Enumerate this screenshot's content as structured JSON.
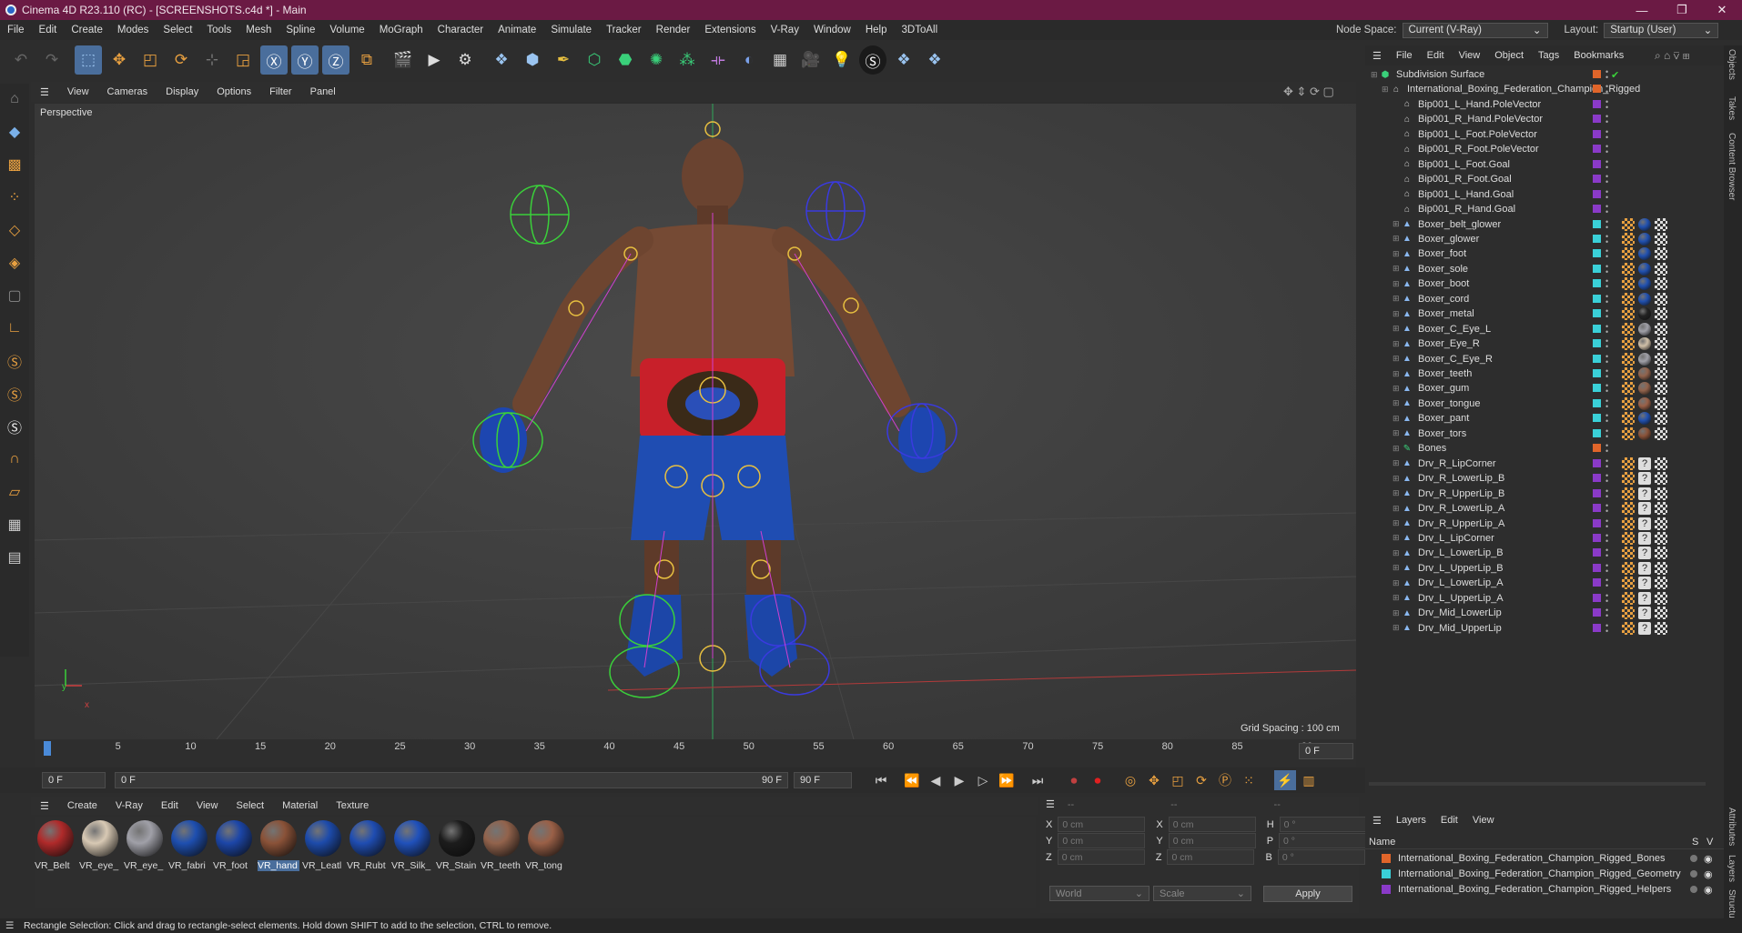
{
  "window": {
    "title": "Cinema 4D R23.110 (RC) - [SCREENSHOTS.c4d *] - Main",
    "controls": [
      "—",
      "❐",
      "✕"
    ]
  },
  "menubar": {
    "items": [
      "File",
      "Edit",
      "Create",
      "Modes",
      "Select",
      "Tools",
      "Mesh",
      "Spline",
      "Volume",
      "MoGraph",
      "Character",
      "Animate",
      "Simulate",
      "Tracker",
      "Render",
      "Extensions",
      "V-Ray",
      "Window",
      "Help",
      "3DToAll"
    ],
    "node_space_label": "Node Space:",
    "node_space_value": "Current (V-Ray)",
    "layout_label": "Layout:",
    "layout_value": "Startup (User)"
  },
  "viewport": {
    "menu": [
      "View",
      "Cameras",
      "Display",
      "Options",
      "Filter",
      "Panel"
    ],
    "label": "Perspective",
    "grid_spacing": "Grid Spacing : 100 cm",
    "axis_y": "y",
    "axis_x": "x"
  },
  "timeline": {
    "ticks": [
      "0",
      "5",
      "10",
      "15",
      "20",
      "25",
      "30",
      "35",
      "40",
      "45",
      "50",
      "55",
      "60",
      "65",
      "70",
      "75",
      "80",
      "85",
      "90"
    ],
    "end_field": "0 F",
    "start_field": "0 F",
    "range_start": "0 F",
    "range_end": "90 F",
    "max_field": "90 F",
    "playhead": 0,
    "max_frame": 90
  },
  "materials": {
    "menu": [
      "Create",
      "V-Ray",
      "Edit",
      "View",
      "Select",
      "Material",
      "Texture"
    ],
    "items": [
      {
        "name": "VR_Belt",
        "color": "#b02a2a"
      },
      {
        "name": "VR_eye_",
        "color": "#d8c9b4"
      },
      {
        "name": "VR_eye_",
        "color": "#a0a0a8"
      },
      {
        "name": "VR_fabri",
        "color": "#1e4fb0"
      },
      {
        "name": "VR_foot",
        "color": "#1c46a8"
      },
      {
        "name": "VR_hand",
        "color": "#8a5238"
      },
      {
        "name": "VR_Leatl",
        "color": "#1d4bab"
      },
      {
        "name": "VR_Rubt",
        "color": "#1f4db2"
      },
      {
        "name": "VR_Silk_",
        "color": "#2051bb"
      },
      {
        "name": "VR_Stain",
        "color": "#1c1c1c"
      },
      {
        "name": "VR_teeth",
        "color": "#92634c"
      },
      {
        "name": "VR_tong",
        "color": "#9a6047"
      }
    ],
    "selected_index": 5
  },
  "coords": {
    "header_left": "--",
    "header_mid": "--",
    "header_right": "--",
    "rows": [
      {
        "a": "X",
        "av": "0 cm",
        "b": "X",
        "bv": "0 cm",
        "c": "H",
        "cv": "0 °"
      },
      {
        "a": "Y",
        "av": "0 cm",
        "b": "Y",
        "bv": "0 cm",
        "c": "P",
        "cv": "0 °"
      },
      {
        "a": "Z",
        "av": "0 cm",
        "b": "Z",
        "bv": "0 cm",
        "c": "B",
        "cv": "0 °"
      }
    ],
    "space": "World",
    "mode": "Scale",
    "apply": "Apply"
  },
  "objects": {
    "menu": [
      "File",
      "Edit",
      "View",
      "Object",
      "Tags",
      "Bookmarks"
    ],
    "rows": [
      {
        "name": "Subdivision Surface",
        "kind": "subdiv",
        "color": "#e0652a",
        "indent": 0,
        "tags": "check"
      },
      {
        "name": "International_Boxing_Federation_Champion_Rigged",
        "kind": "null",
        "color": "#e0652a",
        "indent": 1,
        "tags": ""
      },
      {
        "name": "Bip001_L_Hand.PoleVector",
        "kind": "null",
        "color": "#8a3ac8",
        "indent": 2,
        "tags": ""
      },
      {
        "name": "Bip001_R_Hand.PoleVector",
        "kind": "null",
        "color": "#8a3ac8",
        "indent": 2,
        "tags": ""
      },
      {
        "name": "Bip001_L_Foot.PoleVector",
        "kind": "null",
        "color": "#8a3ac8",
        "indent": 2,
        "tags": ""
      },
      {
        "name": "Bip001_R_Foot.PoleVector",
        "kind": "null",
        "color": "#8a3ac8",
        "indent": 2,
        "tags": ""
      },
      {
        "name": "Bip001_L_Foot.Goal",
        "kind": "null",
        "color": "#8a3ac8",
        "indent": 2,
        "tags": ""
      },
      {
        "name": "Bip001_R_Foot.Goal",
        "kind": "null",
        "color": "#8a3ac8",
        "indent": 2,
        "tags": ""
      },
      {
        "name": "Bip001_L_Hand.Goal",
        "kind": "null",
        "color": "#8a3ac8",
        "indent": 2,
        "tags": ""
      },
      {
        "name": "Bip001_R_Hand.Goal",
        "kind": "null",
        "color": "#8a3ac8",
        "indent": 2,
        "tags": ""
      },
      {
        "name": "Boxer_belt_glower",
        "kind": "mesh",
        "color": "#3ad0d8",
        "indent": 2,
        "tags": "mat",
        "tagcolor": "#2050b0"
      },
      {
        "name": "Boxer_glower",
        "kind": "mesh",
        "color": "#3ad0d8",
        "indent": 2,
        "tags": "mat",
        "tagcolor": "#2050b0"
      },
      {
        "name": "Boxer_foot",
        "kind": "mesh",
        "color": "#3ad0d8",
        "indent": 2,
        "tags": "mat",
        "tagcolor": "#2050b0"
      },
      {
        "name": "Boxer_sole",
        "kind": "mesh",
        "color": "#3ad0d8",
        "indent": 2,
        "tags": "mat",
        "tagcolor": "#2050b0"
      },
      {
        "name": "Boxer_boot",
        "kind": "mesh",
        "color": "#3ad0d8",
        "indent": 2,
        "tags": "mat",
        "tagcolor": "#2050b0"
      },
      {
        "name": "Boxer_cord",
        "kind": "mesh",
        "color": "#3ad0d8",
        "indent": 2,
        "tags": "mat",
        "tagcolor": "#2050b0"
      },
      {
        "name": "Boxer_metal",
        "kind": "mesh",
        "color": "#3ad0d8",
        "indent": 2,
        "tags": "mat",
        "tagcolor": "#222222"
      },
      {
        "name": "Boxer_C_Eye_L",
        "kind": "mesh",
        "color": "#3ad0d8",
        "indent": 2,
        "tags": "mat",
        "tagcolor": "#a0a0a8"
      },
      {
        "name": "Boxer_Eye_R",
        "kind": "mesh",
        "color": "#3ad0d8",
        "indent": 2,
        "tags": "mat",
        "tagcolor": "#d0c0a8"
      },
      {
        "name": "Boxer_C_Eye_R",
        "kind": "mesh",
        "color": "#3ad0d8",
        "indent": 2,
        "tags": "mat",
        "tagcolor": "#a0a0a8"
      },
      {
        "name": "Boxer_teeth",
        "kind": "mesh",
        "color": "#3ad0d8",
        "indent": 2,
        "tags": "mat",
        "tagcolor": "#92634c"
      },
      {
        "name": "Boxer_gum",
        "kind": "mesh",
        "color": "#3ad0d8",
        "indent": 2,
        "tags": "mat",
        "tagcolor": "#92634c"
      },
      {
        "name": "Boxer_tongue",
        "kind": "mesh",
        "color": "#3ad0d8",
        "indent": 2,
        "tags": "mat",
        "tagcolor": "#9a6047"
      },
      {
        "name": "Boxer_pant",
        "kind": "mesh",
        "color": "#3ad0d8",
        "indent": 2,
        "tags": "mat",
        "tagcolor": "#2050b0"
      },
      {
        "name": "Boxer_tors",
        "kind": "mesh",
        "color": "#3ad0d8",
        "indent": 2,
        "tags": "mat",
        "tagcolor": "#8a5238"
      },
      {
        "name": "Bones",
        "kind": "bone",
        "color": "#e0652a",
        "indent": 2,
        "tags": ""
      },
      {
        "name": "Drv_R_LipCorner",
        "kind": "mesh",
        "color": "#8a3ac8",
        "indent": 2,
        "tags": "q"
      },
      {
        "name": "Drv_R_LowerLip_B",
        "kind": "mesh",
        "color": "#8a3ac8",
        "indent": 2,
        "tags": "q"
      },
      {
        "name": "Drv_R_UpperLip_B",
        "kind": "mesh",
        "color": "#8a3ac8",
        "indent": 2,
        "tags": "q"
      },
      {
        "name": "Drv_R_LowerLip_A",
        "kind": "mesh",
        "color": "#8a3ac8",
        "indent": 2,
        "tags": "q"
      },
      {
        "name": "Drv_R_UpperLip_A",
        "kind": "mesh",
        "color": "#8a3ac8",
        "indent": 2,
        "tags": "q"
      },
      {
        "name": "Drv_L_LipCorner",
        "kind": "mesh",
        "color": "#8a3ac8",
        "indent": 2,
        "tags": "q"
      },
      {
        "name": "Drv_L_LowerLip_B",
        "kind": "mesh",
        "color": "#8a3ac8",
        "indent": 2,
        "tags": "q"
      },
      {
        "name": "Drv_L_UpperLip_B",
        "kind": "mesh",
        "color": "#8a3ac8",
        "indent": 2,
        "tags": "q"
      },
      {
        "name": "Drv_L_LowerLip_A",
        "kind": "mesh",
        "color": "#8a3ac8",
        "indent": 2,
        "tags": "q"
      },
      {
        "name": "Drv_L_UpperLip_A",
        "kind": "mesh",
        "color": "#8a3ac8",
        "indent": 2,
        "tags": "q"
      },
      {
        "name": "Drv_Mid_LowerLip",
        "kind": "mesh",
        "color": "#8a3ac8",
        "indent": 2,
        "tags": "q"
      },
      {
        "name": "Drv_Mid_UpperLip",
        "kind": "mesh",
        "color": "#8a3ac8",
        "indent": 2,
        "tags": "q"
      }
    ]
  },
  "layers": {
    "menu": [
      "Layers",
      "Edit",
      "View"
    ],
    "col_name": "Name",
    "col_s": "S",
    "col_v": "V",
    "rows": [
      {
        "name": "International_Boxing_Federation_Champion_Rigged_Bones",
        "color": "#e0652a"
      },
      {
        "name": "International_Boxing_Federation_Champion_Rigged_Geometry",
        "color": "#3ad0d8"
      },
      {
        "name": "International_Boxing_Federation_Champion_Rigged_Helpers",
        "color": "#8a3ac8"
      }
    ]
  },
  "right_tabs": [
    "Objects",
    "Takes",
    "Content Browser",
    "Attributes",
    "Layers",
    "Structure"
  ],
  "status": "Rectangle Selection: Click and drag to rectangle-select elements. Hold down SHIFT to add to the selection, CTRL to remove."
}
